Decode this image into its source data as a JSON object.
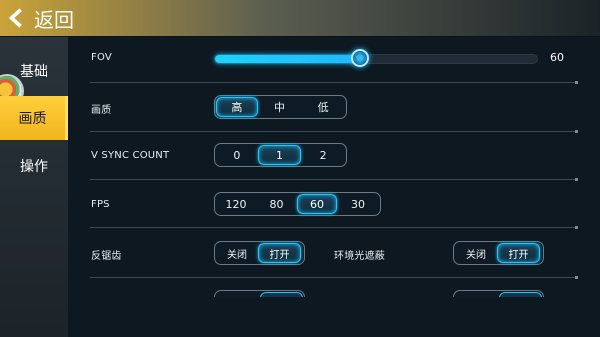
{
  "header": {
    "back_label": "返回"
  },
  "sidebar": {
    "items": [
      {
        "label": "基础",
        "active": false
      },
      {
        "label": "画质",
        "active": true
      },
      {
        "label": "操作",
        "active": false
      }
    ]
  },
  "settings": {
    "fov": {
      "label": "FOV",
      "value": "60",
      "level": 0.45
    },
    "quality": {
      "label": "画质",
      "options": [
        "高",
        "中",
        "低"
      ],
      "selected": "高"
    },
    "vsync": {
      "label": "V SYNC COUNT",
      "options": [
        "0",
        "1",
        "2"
      ],
      "selected": "1"
    },
    "fps": {
      "label": "FPS",
      "options": [
        "120",
        "80",
        "60",
        "30"
      ],
      "selected": "60"
    },
    "antialias": {
      "label": "反锯齿",
      "options": [
        "关闭",
        "打开"
      ],
      "selected": "打开"
    },
    "ao": {
      "label": "环境光遮蔽",
      "options": [
        "关闭",
        "打开"
      ],
      "selected": "打开"
    }
  },
  "colors": {
    "accent": "#1fc6ff",
    "active_tab": "#f1b51c",
    "header_gold": "#caa33a"
  }
}
